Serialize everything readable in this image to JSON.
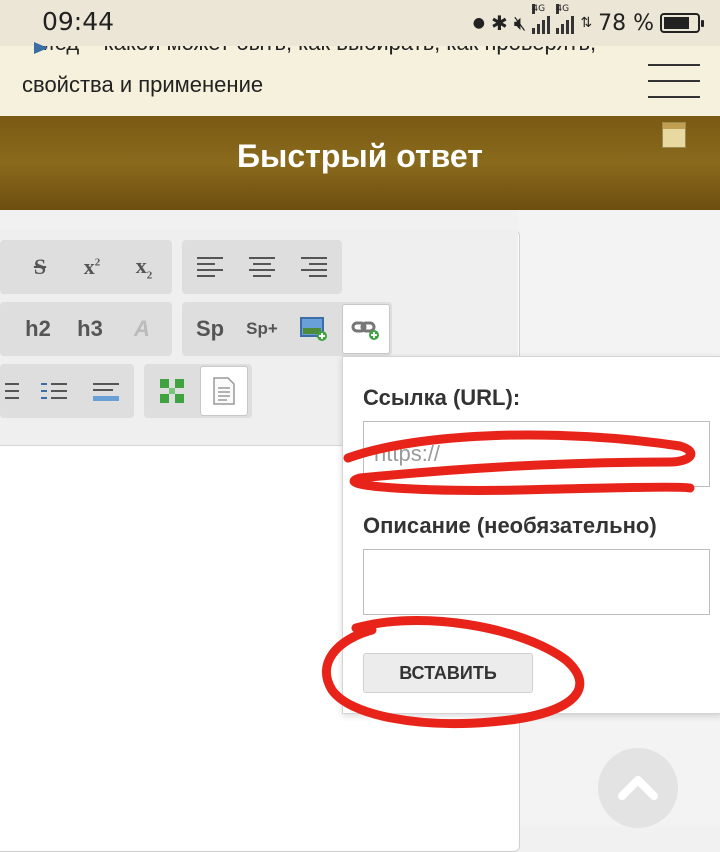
{
  "status_bar": {
    "time": "09:44",
    "network_type": "4G",
    "battery_percent_text": "78 %",
    "battery_level": 0.78
  },
  "header": {
    "breadcrumb_line1": "Мед – какой может быть, как выбирать, как проверять,",
    "breadcrumb_line2": "свойства и применение"
  },
  "title_bar": {
    "title": "Быстрый ответ"
  },
  "toolbar": {
    "row1": [
      "strikethrough-icon",
      "superscript-icon",
      "subscript-icon",
      "align-left-icon",
      "align-center-icon",
      "align-right-icon"
    ],
    "row2": {
      "h2": "h2",
      "h3": "h3",
      "sp": "Sp",
      "sp_plus": "Sp+"
    },
    "row3": [
      "bullet-list-icon",
      "numbered-list-icon",
      "divider-icon",
      "grid-icon",
      "document-icon"
    ]
  },
  "link_popup": {
    "url_label": "Ссылка (URL):",
    "url_placeholder": "https://",
    "desc_label": "Описание (необязательно)",
    "desc_value": "",
    "insert_button": "ВСТАВИТЬ"
  },
  "colors": {
    "title_bar": "#7a5a14",
    "header_bg": "#f6f1dd",
    "annotation": "#e8241a"
  }
}
